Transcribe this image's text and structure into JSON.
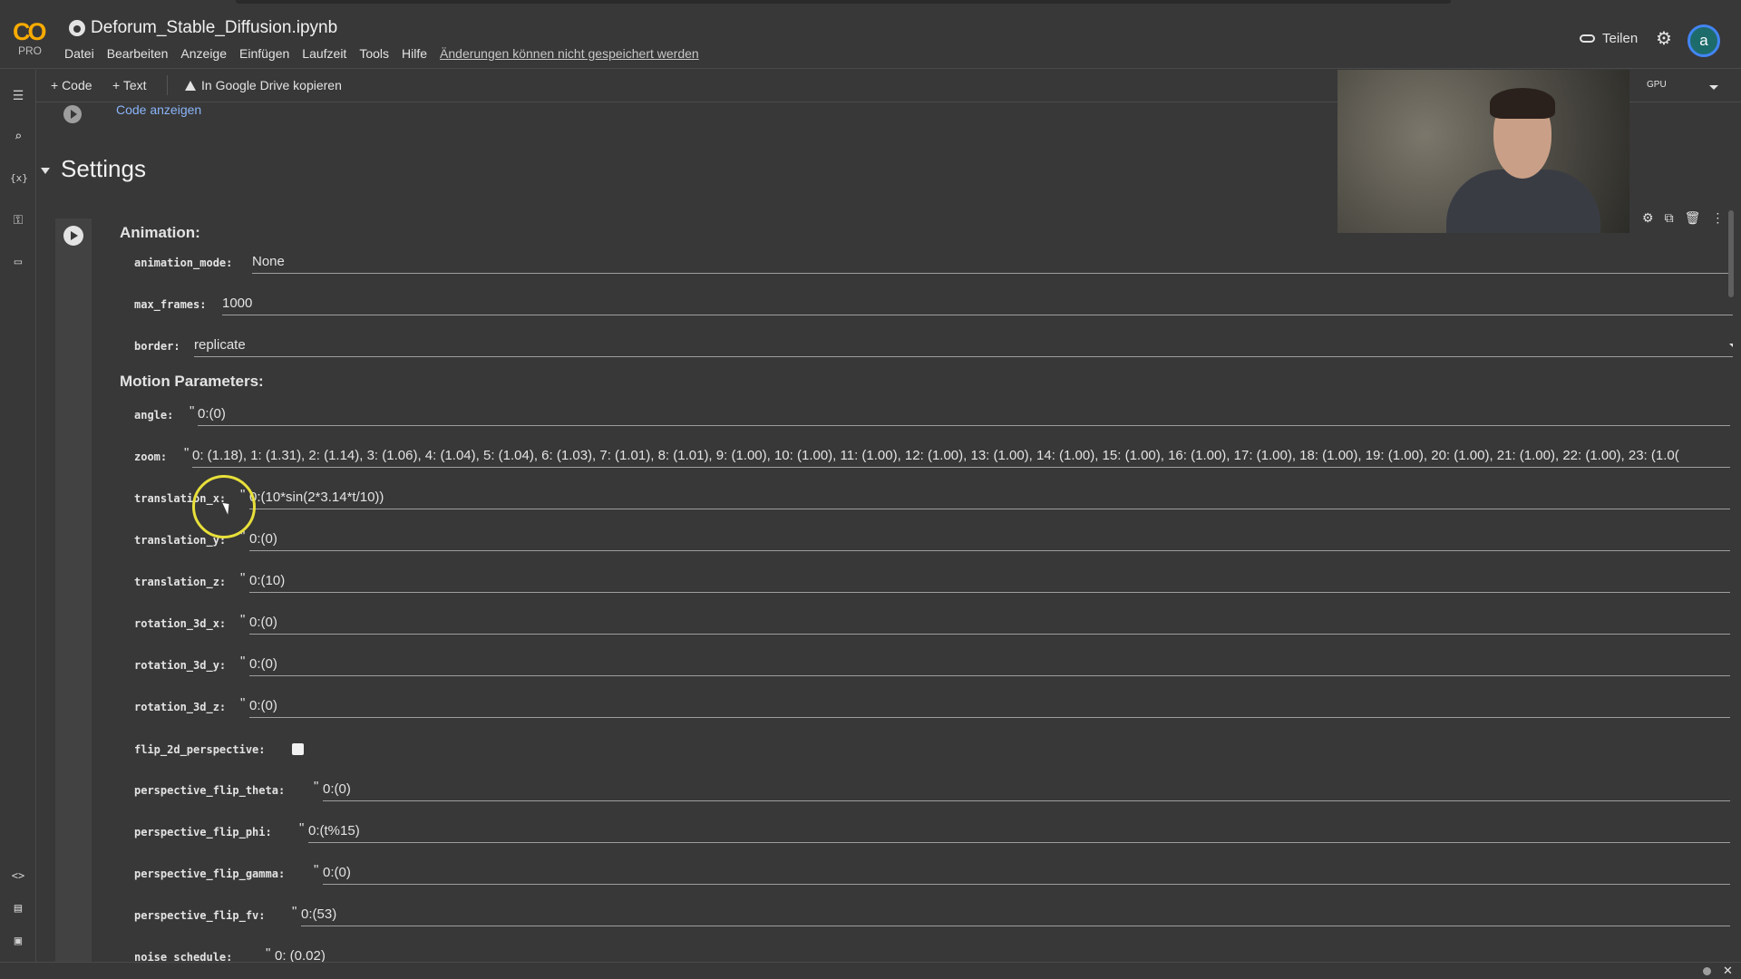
{
  "app": {
    "logo_text": "CO",
    "plan": "PRO",
    "notebook_title": "Deforum_Stable_Diffusion.ipynb",
    "menu": [
      "Datei",
      "Bearbeiten",
      "Anzeige",
      "Einfügen",
      "Laufzeit",
      "Tools",
      "Hilfe"
    ],
    "unsaved_notice": "Änderungen können nicht gespeichert werden",
    "share_label": "Teilen",
    "avatar_letter": "a"
  },
  "toolbar": {
    "add_code": "+ Code",
    "add_text": "+ Text",
    "copy_drive": "In Google Drive kopieren",
    "runtime": "GPU"
  },
  "sidebar": {
    "icons": [
      "menu-icon",
      "search-icon",
      "variables-icon",
      "key-icon",
      "folder-icon",
      "code-snippets-icon",
      "command-palette-icon",
      "terminal-icon"
    ]
  },
  "notebook": {
    "show_code": "Code anzeigen",
    "section_title": "Settings",
    "animation_heading": "Animation:",
    "motion_heading": "Motion Parameters:",
    "params": {
      "animation_mode": {
        "label": "animation_mode:",
        "value": "None"
      },
      "max_frames": {
        "label": "max_frames:",
        "value": "1000"
      },
      "border": {
        "label": "border:",
        "value": "replicate"
      },
      "angle": {
        "label": "angle:",
        "value": "0:(0)"
      },
      "zoom": {
        "label": "zoom:",
        "value": "0: (1.18), 1: (1.31), 2: (1.14), 3: (1.06), 4: (1.04), 5: (1.04), 6: (1.03), 7: (1.01), 8: (1.01), 9: (1.00), 10: (1.00), 11: (1.00), 12: (1.00), 13: (1.00), 14: (1.00), 15: (1.00), 16: (1.00), 17: (1.00), 18: (1.00), 19: (1.00), 20: (1.00), 21: (1.00), 22: (1.00), 23: (1.0("
      },
      "translation_x": {
        "label": "translation_x:",
        "value": "0:(10*sin(2*3.14*t/10))"
      },
      "translation_y": {
        "label": "translation_y:",
        "value": "0:(0)"
      },
      "translation_z": {
        "label": "translation_z:",
        "value": "0:(10)"
      },
      "rotation_3d_x": {
        "label": "rotation_3d_x:",
        "value": "0:(0)"
      },
      "rotation_3d_y": {
        "label": "rotation_3d_y:",
        "value": "0:(0)"
      },
      "rotation_3d_z": {
        "label": "rotation_3d_z:",
        "value": "0:(0)"
      },
      "flip_2d_perspective": {
        "label": "flip_2d_perspective:"
      },
      "perspective_flip_theta": {
        "label": "perspective_flip_theta:",
        "value": "0:(0)"
      },
      "perspective_flip_phi": {
        "label": "perspective_flip_phi:",
        "value": "0:(t%15)"
      },
      "perspective_flip_gamma": {
        "label": "perspective_flip_gamma:",
        "value": "0:(0)"
      },
      "perspective_flip_fv": {
        "label": "perspective_flip_fv:",
        "value": "0:(53)"
      },
      "noise_schedule": {
        "label": "noise_schedule:",
        "value": "0: (0.02)"
      }
    }
  }
}
